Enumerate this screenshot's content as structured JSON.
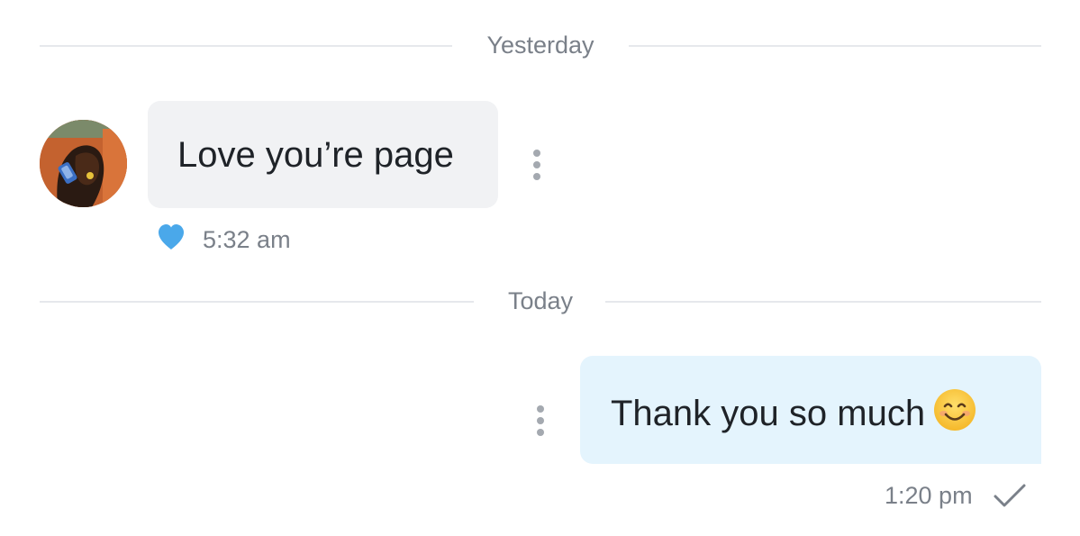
{
  "dividers": {
    "yesterday": "Yesterday",
    "today": "Today"
  },
  "messages": [
    {
      "direction": "incoming",
      "text": "Love you’re page",
      "time": "5:32 am",
      "reaction_icon": "heart-icon",
      "reaction_color": "#4aa8ea"
    },
    {
      "direction": "outgoing",
      "text": "Thank you so much",
      "emoji_icon": "smiling-face-emoji",
      "time": "1:20 pm",
      "status_icon": "checkmark-icon"
    }
  ],
  "colors": {
    "incoming_bubble": "#f1f2f4",
    "outgoing_bubble": "#e4f4fd",
    "divider_line": "#e6e8ec",
    "meta_text": "#7a8089",
    "heart": "#4aa8ea"
  }
}
